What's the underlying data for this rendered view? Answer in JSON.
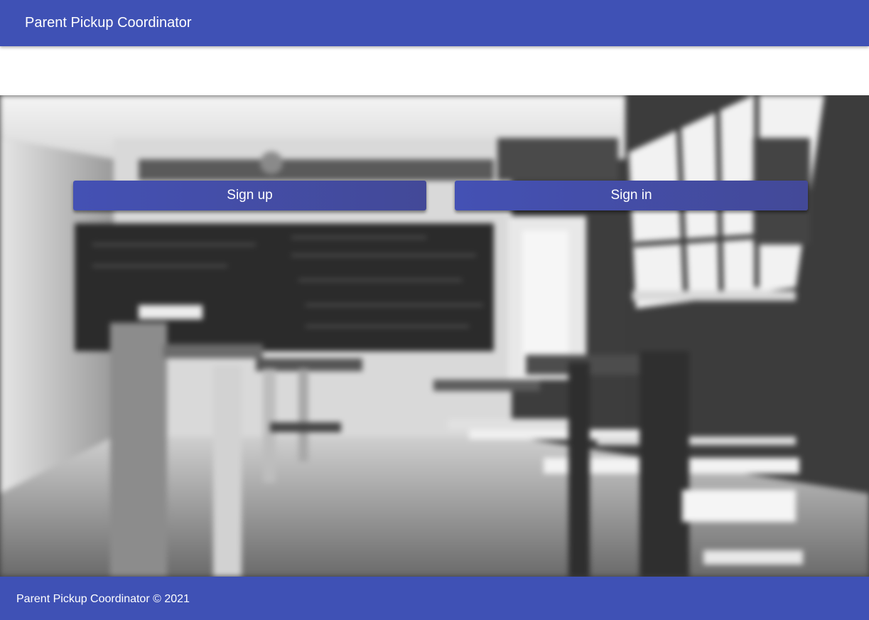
{
  "app": {
    "title": "Parent Pickup Coordinator"
  },
  "hero": {
    "background": "blurred-black-and-white-classroom-photo",
    "signup_label": "Sign up",
    "signin_label": "Sign in"
  },
  "footer": {
    "text": "Parent Pickup Coordinator © 2021"
  },
  "colors": {
    "primary": "#3f51b5",
    "on_primary": "#ffffff"
  }
}
